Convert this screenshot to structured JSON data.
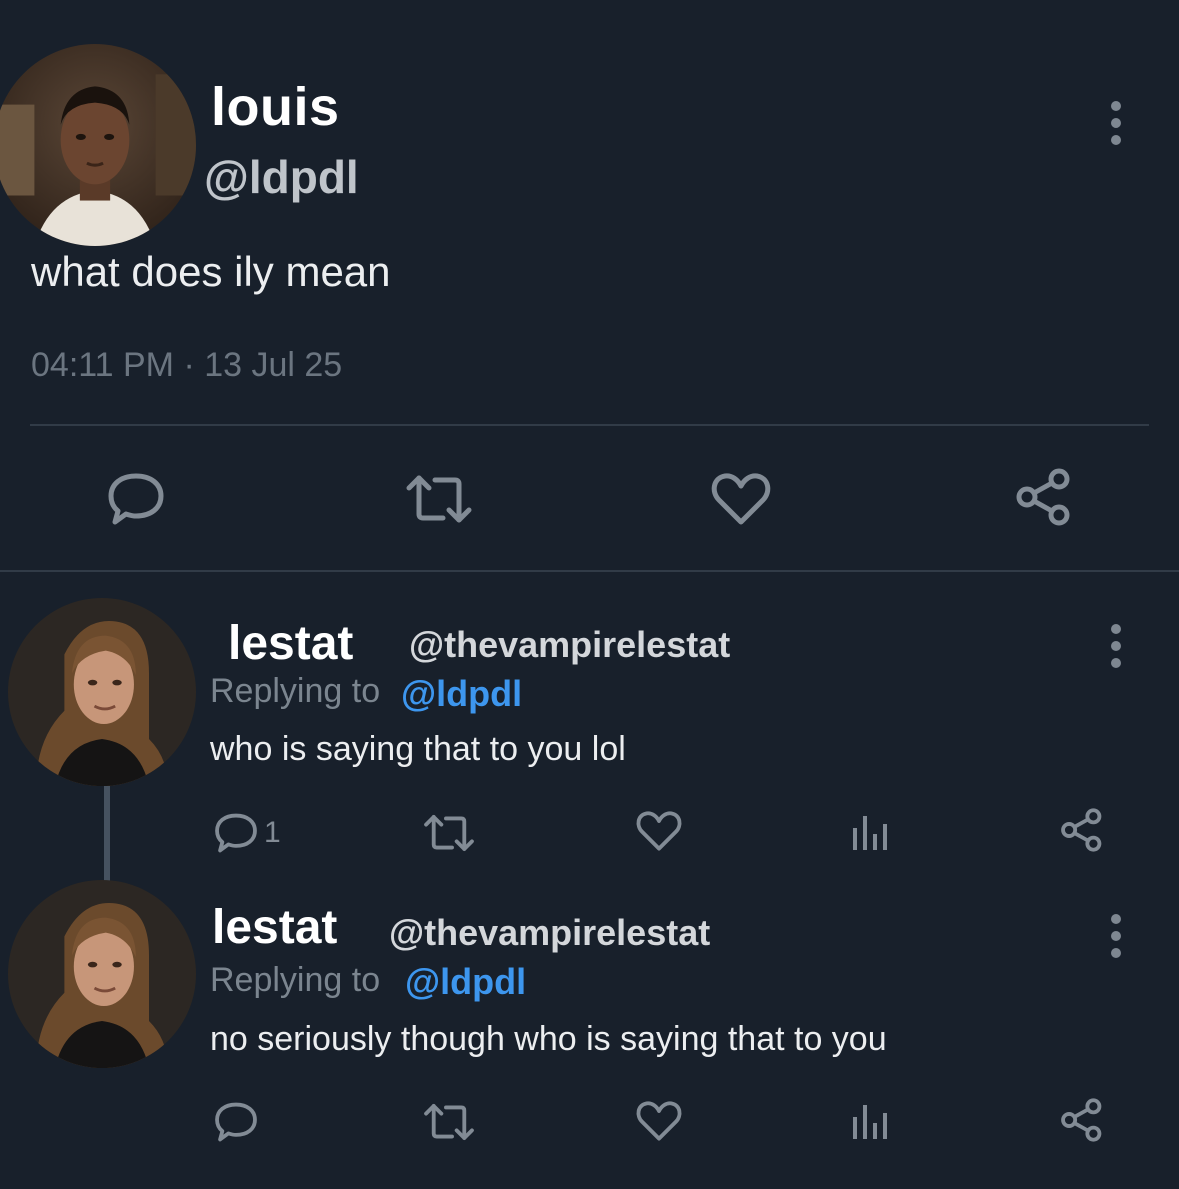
{
  "main_post": {
    "display_name": "louis",
    "handle": "@ldpdl",
    "text": "what does ily mean",
    "timestamp": "04:11 PM · 13 Jul 25",
    "actions": [
      "reply-icon",
      "repost-icon",
      "like-icon",
      "share-icon"
    ]
  },
  "replies": [
    {
      "display_name": "lestat",
      "handle": "@thevampirelestat",
      "replying_label": "Replying to",
      "replying_to": "@ldpdl",
      "text": "who is saying that to you lol",
      "reply_count": "1",
      "actions": [
        "reply-icon",
        "repost-icon",
        "like-icon",
        "views-icon",
        "share-icon"
      ]
    },
    {
      "display_name": "lestat",
      "handle": "@thevampirelestat",
      "replying_label": "Replying to",
      "replying_to": "@ldpdl",
      "text": "no seriously though who is saying that to you",
      "actions": [
        "reply-icon",
        "repost-icon",
        "like-icon",
        "views-icon",
        "share-icon"
      ]
    }
  ],
  "colors": {
    "background": "#18202b",
    "mention": "#3d96ee",
    "icon": "#828b95",
    "divider": "#313b47"
  }
}
